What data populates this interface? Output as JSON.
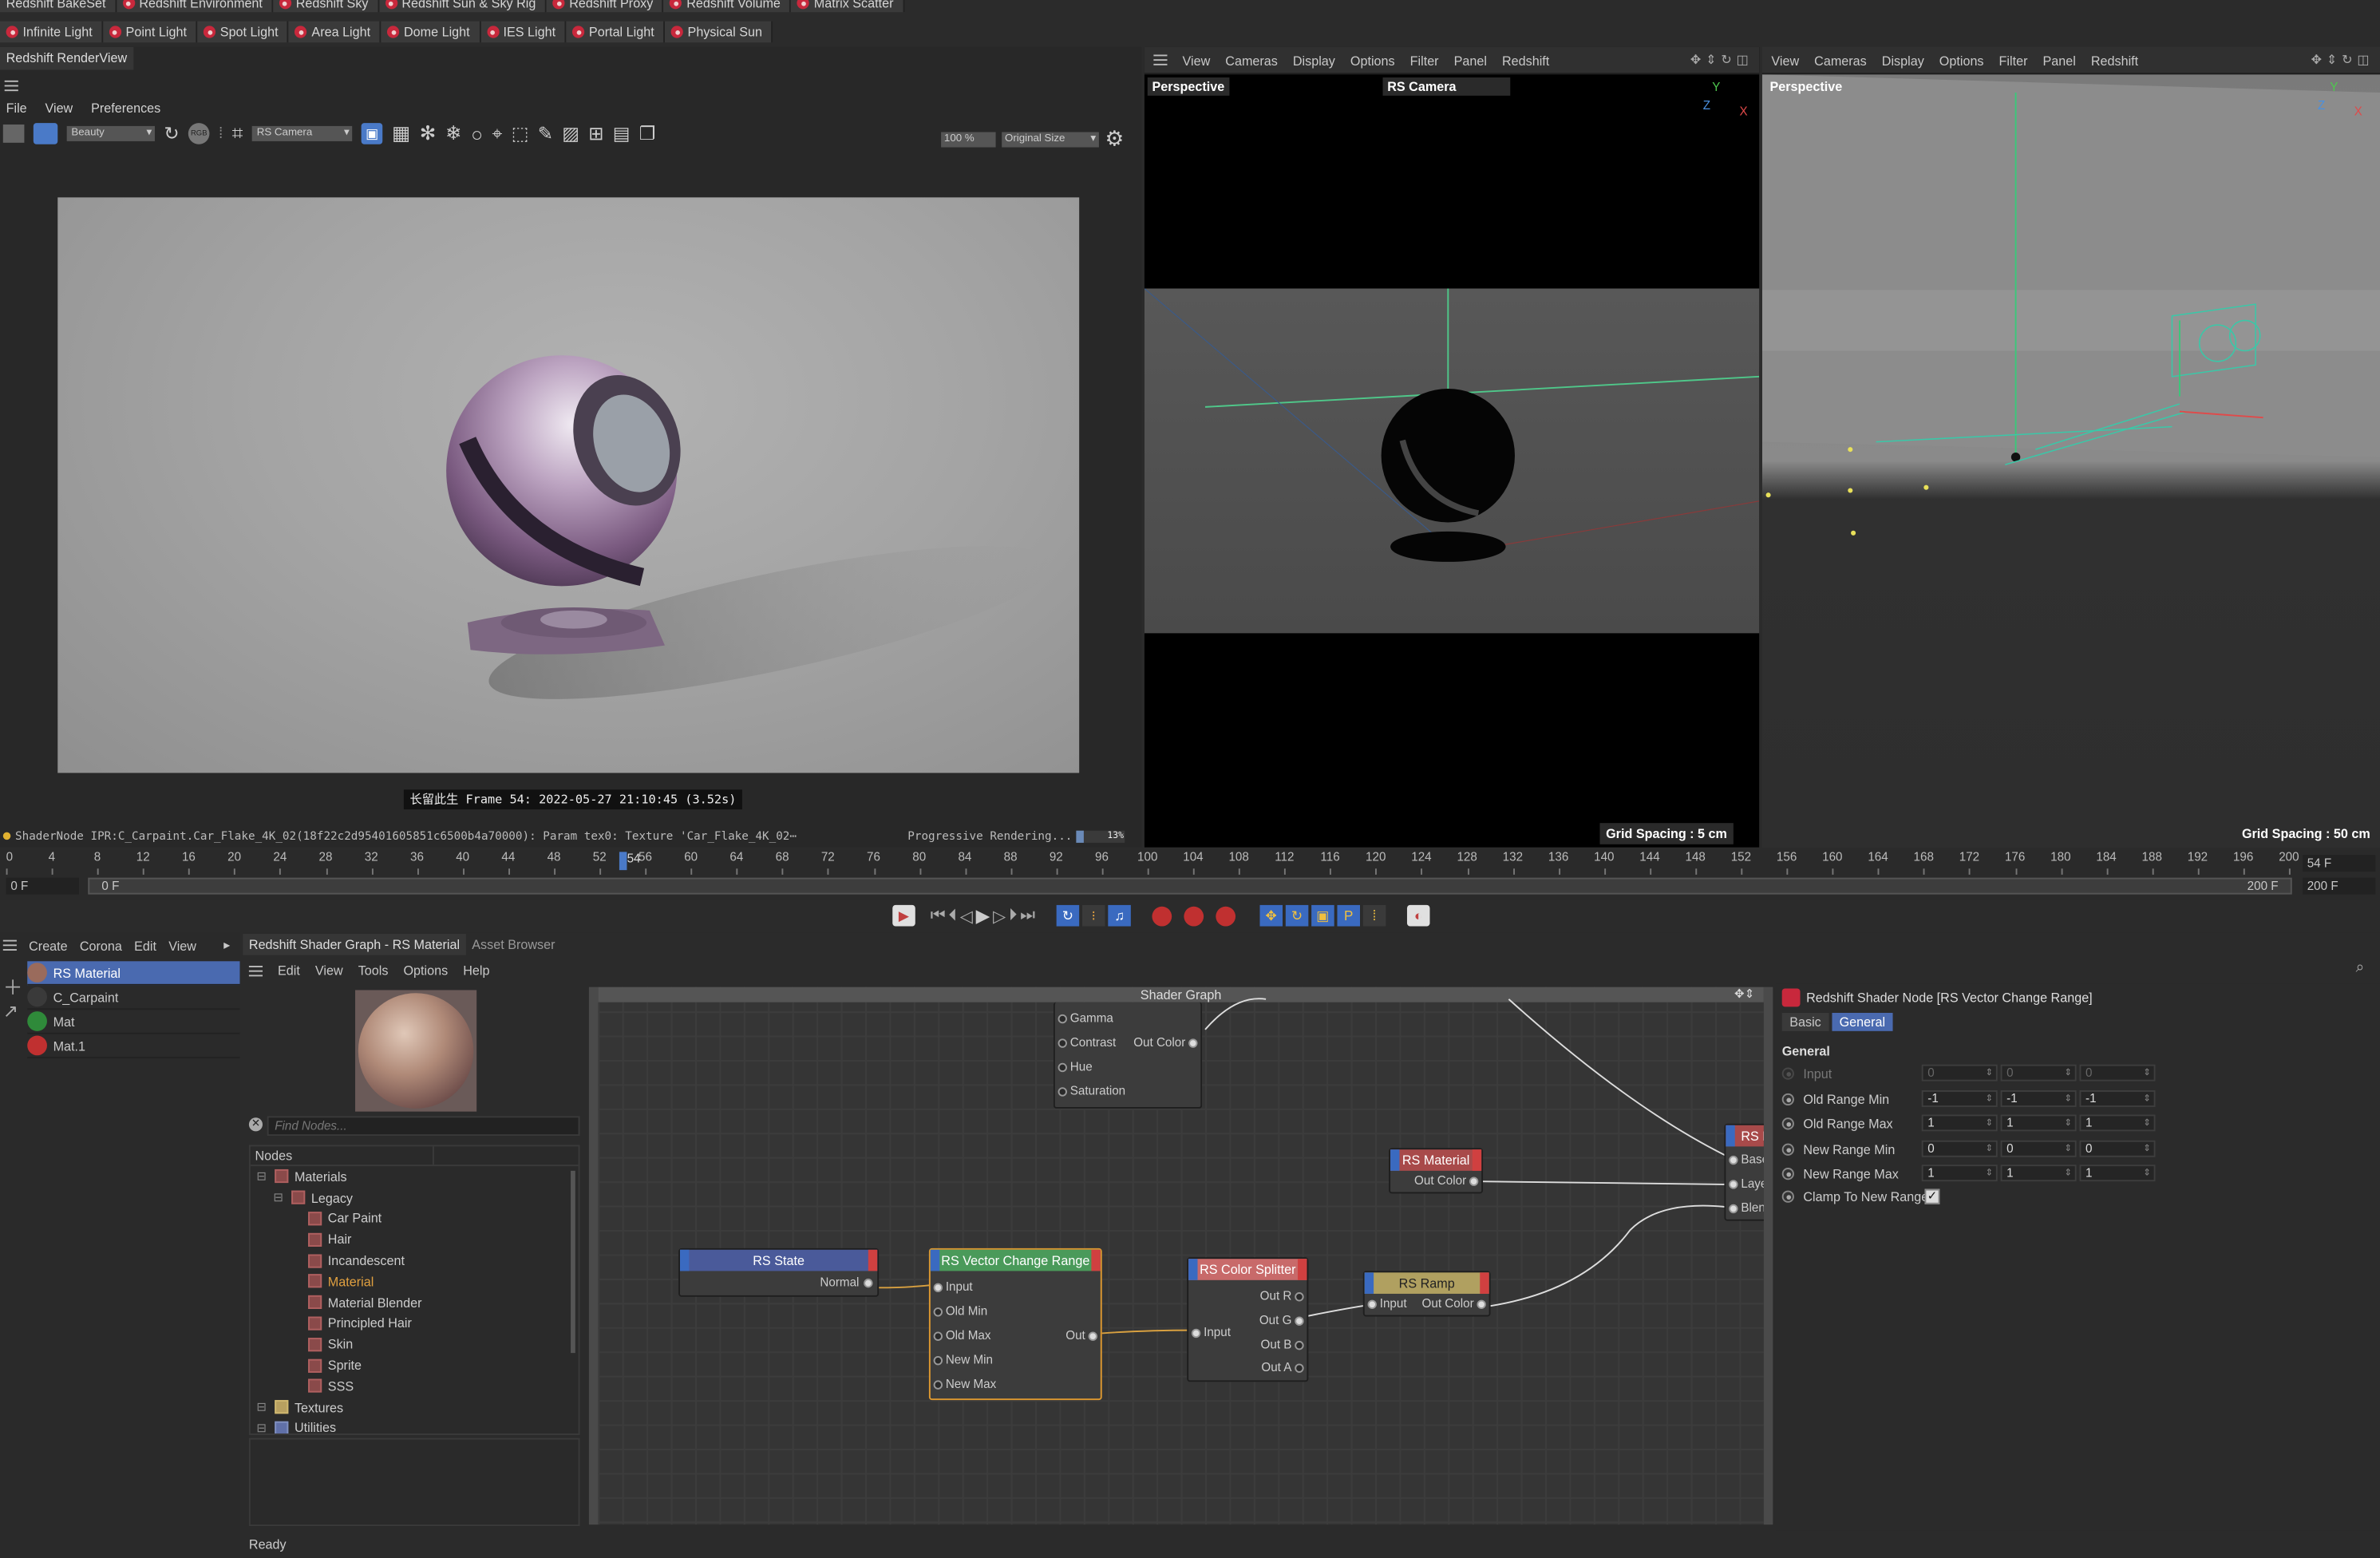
{
  "toolbar_row1": [
    "Redshift BakeSet",
    "Redshift Environment",
    "Redshift Sky",
    "Redshift Sun & Sky Rig",
    "Redshift Proxy",
    "Redshift Volume",
    "Matrix Scatter"
  ],
  "toolbar_row2": [
    "Infinite Light",
    "Point Light",
    "Spot Light",
    "Area Light",
    "Dome Light",
    "IES Light",
    "Portal Light",
    "Physical Sun"
  ],
  "renderview": {
    "title": "Redshift RenderView",
    "menu": [
      "File",
      "View",
      "Preferences"
    ],
    "aov": "Beauty",
    "camera": "RS Camera",
    "zoom": "100 %",
    "size_mode": "Original Size",
    "rgb_label": "RGB",
    "caption": "长留此生  Frame  54:  2022-05-27  21:10:45  (3.52s)",
    "status": "ShaderNode IPR:C_Carpaint.Car_Flake_4K_02(18f22c2d95401605851c6500b4a70000): Param tex0: Texture 'Car_Flake_4K_02⋯",
    "progress_text": "Progressive Rendering...",
    "progress_pct": "13%",
    "progress": 0.13
  },
  "viewport1": {
    "menu": [
      "View",
      "Cameras",
      "Display",
      "Options",
      "Filter",
      "Panel",
      "Redshift"
    ],
    "label": "Perspective",
    "camera": "RS Camera",
    "grid": "Grid Spacing : 5 cm"
  },
  "viewport2": {
    "menu": [
      "View",
      "Cameras",
      "Display",
      "Options",
      "Filter",
      "Panel",
      "Redshift"
    ],
    "label": "Perspective",
    "grid": "Grid Spacing : 50 cm"
  },
  "timeline": {
    "ticks": [
      "0",
      "4",
      "8",
      "12",
      "16",
      "20",
      "24",
      "28",
      "32",
      "36",
      "40",
      "44",
      "48",
      "52",
      "56",
      "60",
      "64",
      "68",
      "72",
      "76",
      "80",
      "84",
      "88",
      "92",
      "96",
      "100",
      "104",
      "108",
      "112",
      "116",
      "120",
      "124",
      "128",
      "132",
      "136",
      "140",
      "144",
      "148",
      "152",
      "156",
      "160",
      "164",
      "168",
      "172",
      "176",
      "180",
      "184",
      "188",
      "192",
      "196",
      "200"
    ],
    "current_frame_label": "54",
    "current_frame": 54,
    "right_field": "54 F",
    "start_field": "0 F",
    "range_start": "0 F",
    "range_end": "200 F",
    "end_field": "200 F"
  },
  "material_manager": {
    "menu": [
      "Create",
      "Corona",
      "Edit",
      "View"
    ],
    "items": [
      "RS Material",
      "C_Carpaint",
      "Mat",
      "Mat.1"
    ],
    "item_colors": [
      "#9a6b5c",
      "#3a3a3a",
      "#2f8a3a",
      "#c03030"
    ]
  },
  "shader_graph": {
    "title": "Redshift Shader Graph - RS Material",
    "tab2": "Asset Browser",
    "menu": [
      "Edit",
      "View",
      "Tools",
      "Options",
      "Help"
    ],
    "search_placeholder": "Find Nodes...",
    "nodes_header": "Nodes",
    "tree": [
      {
        "label": "Materials",
        "level": 0
      },
      {
        "label": "Legacy",
        "level": 1
      },
      {
        "label": "Car Paint",
        "level": 2
      },
      {
        "label": "Hair",
        "level": 2
      },
      {
        "label": "Incandescent",
        "level": 2
      },
      {
        "label": "Material",
        "level": 2,
        "highlight": true
      },
      {
        "label": "Material Blender",
        "level": 2
      },
      {
        "label": "Principled Hair",
        "level": 2
      },
      {
        "label": "Skin",
        "level": 2
      },
      {
        "label": "Sprite",
        "level": 2
      },
      {
        "label": "SSS",
        "level": 2
      },
      {
        "label": "Textures",
        "level": 0
      },
      {
        "label": "Utilities",
        "level": 0
      }
    ],
    "canvas_title": "Shader Graph",
    "node_cc_ports": [
      "Gamma",
      "Contrast",
      "Hue",
      "Saturation"
    ],
    "node_cc_out": "Out Color",
    "node_state": {
      "title": "RS State",
      "out": "Normal"
    },
    "node_vcr": {
      "title": "RS Vector Change Range",
      "inputs": [
        "Input",
        "Old Min",
        "Old Max",
        "New Min",
        "New Max"
      ],
      "out": "Out"
    },
    "node_splitter": {
      "title": "RS Color Splitter",
      "input": "Input",
      "outs": [
        "Out R",
        "Out G",
        "Out B",
        "Out A"
      ]
    },
    "node_ramp": {
      "title": "RS Ramp",
      "input": "Input",
      "out": "Out Color"
    },
    "node_material": {
      "title": "RS Material",
      "out": "Out Color"
    },
    "node_final": {
      "title": "RS M",
      "ports": [
        "Base",
        "Layer",
        "Blend"
      ]
    }
  },
  "attributes": {
    "title": "Redshift Shader Node [RS Vector Change Range]",
    "tabs": [
      "Basic",
      "General"
    ],
    "section": "General",
    "rows": [
      {
        "label": "Input",
        "values": [
          "0",
          "0",
          "0"
        ],
        "disabled": true
      },
      {
        "label": "Old Range Min",
        "values": [
          "-1",
          "-1",
          "-1"
        ]
      },
      {
        "label": "Old Range Max",
        "values": [
          "1",
          "1",
          "1"
        ]
      },
      {
        "label": "New Range Min",
        "values": [
          "0",
          "0",
          "0"
        ]
      },
      {
        "label": "New Range Max",
        "values": [
          "1",
          "1",
          "1"
        ]
      }
    ],
    "clamp_label": "Clamp To New Range",
    "clamp_checked": true
  },
  "status_bar": "Ready"
}
